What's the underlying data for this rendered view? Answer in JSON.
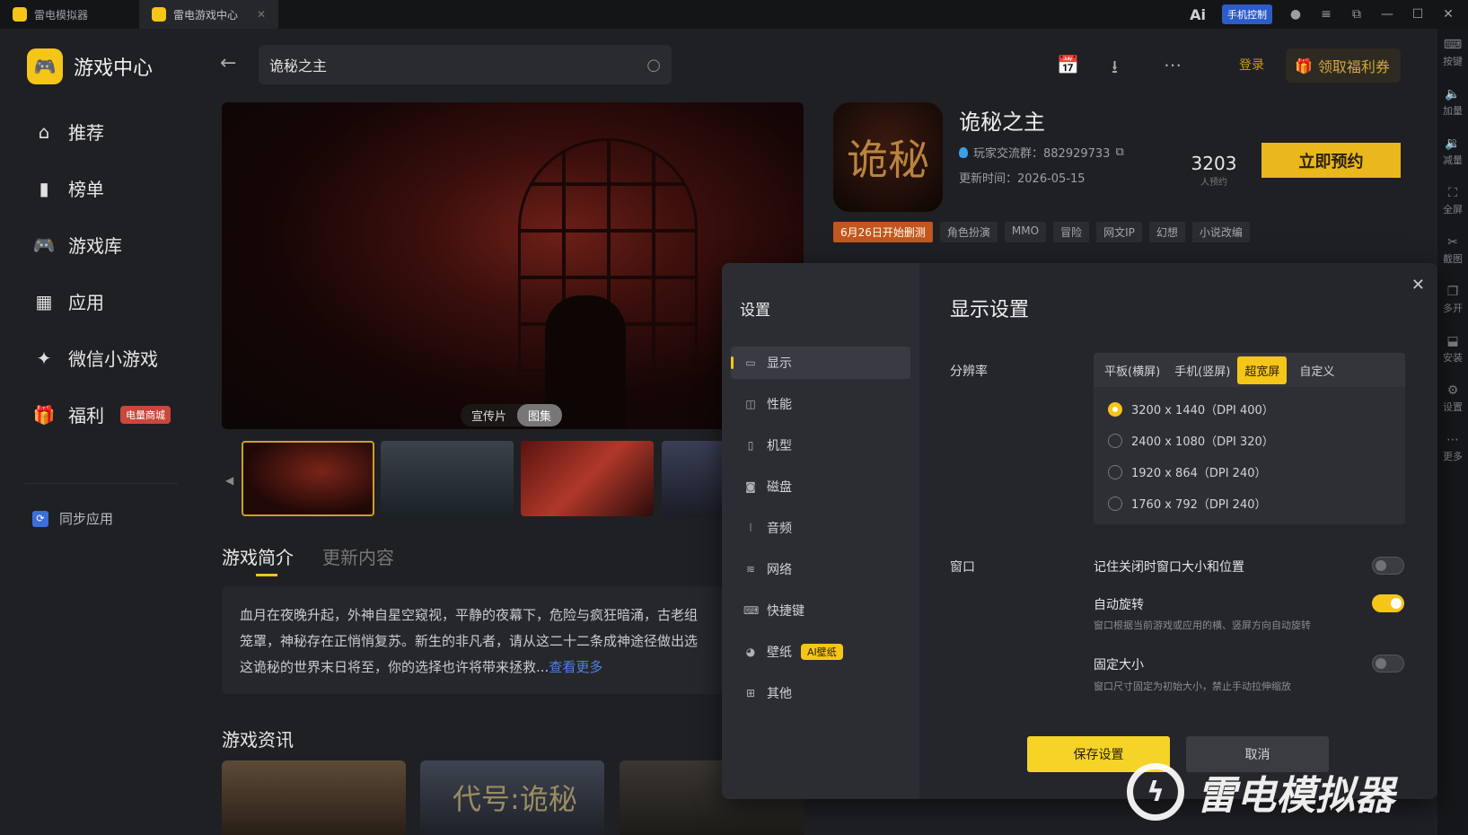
{
  "titlebar": {
    "tabs": [
      {
        "label": "雷电模拟器"
      },
      {
        "label": "雷电游戏中心"
      }
    ],
    "ai_label": "Ai",
    "phone_control": "手机控制"
  },
  "dock": {
    "items": [
      {
        "label": "按键",
        "icon": "keyboard-icon"
      },
      {
        "label": "加量",
        "icon": "volume-up-icon"
      },
      {
        "label": "减量",
        "icon": "volume-down-icon"
      },
      {
        "label": "全屏",
        "icon": "fullscreen-icon"
      },
      {
        "label": "截图",
        "icon": "scissors-icon"
      },
      {
        "label": "多开",
        "icon": "multi-instance-icon"
      },
      {
        "label": "安装",
        "icon": "install-icon"
      },
      {
        "label": "设置",
        "icon": "gear-icon"
      },
      {
        "label": "更多",
        "icon": "more-icon"
      }
    ]
  },
  "sidebar": {
    "brand": "游戏中心",
    "items": [
      {
        "label": "推荐",
        "icon": "home-icon"
      },
      {
        "label": "榜单",
        "icon": "chart-icon"
      },
      {
        "label": "游戏库",
        "icon": "gamepad-icon"
      },
      {
        "label": "应用",
        "icon": "apps-icon"
      },
      {
        "label": "微信小游戏",
        "icon": "mini-game-icon"
      },
      {
        "label": "福利",
        "icon": "gift-icon",
        "badge": "电量商城"
      }
    ],
    "sync": "同步应用"
  },
  "header": {
    "search_value": "诡秘之主",
    "login": "登录",
    "coupon": "领取福利券"
  },
  "media": {
    "tabs": [
      "宣传片",
      "图集"
    ],
    "active_tab": "图集"
  },
  "game": {
    "title": "诡秘之主",
    "icon_text": "诡秘",
    "group": "玩家交流群：882929733",
    "update": "更新时间：2026-05-15",
    "count": "3203",
    "count_label": "人预约",
    "reserve": "立即预约",
    "date_tag": "6月26日开始删测",
    "tags": [
      "角色扮演",
      "MMO",
      "冒险",
      "网文IP",
      "幻想",
      "小说改编"
    ]
  },
  "intro": {
    "tab_active": "游戏简介",
    "tab_other": "更新内容",
    "text": "血月在夜晚升起，外神自星空窥视，平静的夜幕下，危险与疯狂暗涌，古老组笼罩，神秘存在正悄悄复苏。新生的非凡者，请从这二十二条成神途径做出选这诡秘的世界末日将至，你的选择也许将带来拯救...",
    "more": "查看更多"
  },
  "news": {
    "title": "游戏资讯",
    "card2_text": "代号:诡秘"
  },
  "dialog": {
    "title": "设置",
    "menu": [
      {
        "label": "显示",
        "icon": "monitor-icon"
      },
      {
        "label": "性能",
        "icon": "performance-icon"
      },
      {
        "label": "机型",
        "icon": "phone-icon"
      },
      {
        "label": "磁盘",
        "icon": "disk-icon"
      },
      {
        "label": "音频",
        "icon": "audio-icon"
      },
      {
        "label": "网络",
        "icon": "wifi-icon"
      },
      {
        "label": "快捷键",
        "icon": "keyboard-icon"
      },
      {
        "label": "壁纸",
        "icon": "palette-icon",
        "badge": "AI壁纸"
      },
      {
        "label": "其他",
        "icon": "grid-icon"
      }
    ],
    "heading": "显示设置",
    "resolution_label": "分辨率",
    "segments": [
      "平板(横屏)",
      "手机(竖屏)",
      "超宽屏",
      "自定义"
    ],
    "active_segment": "超宽屏",
    "resolutions": [
      {
        "label": "3200 x 1440（DPI 400）",
        "selected": true
      },
      {
        "label": "2400 x 1080（DPI 320）",
        "selected": false
      },
      {
        "label": "1920 x 864（DPI 240）",
        "selected": false
      },
      {
        "label": "1760 x 792（DPI 240）",
        "selected": false
      }
    ],
    "window_label": "窗口",
    "options": [
      {
        "title": "记住关闭时窗口大小和位置",
        "sub": "",
        "on": false
      },
      {
        "title": "自动旋转",
        "sub": "窗口根据当前游戏或应用的横、竖屏方向自动旋转",
        "on": true
      },
      {
        "title": "固定大小",
        "sub": "窗口尺寸固定为初始大小，禁止手动拉伸缩放",
        "on": false
      }
    ],
    "save": "保存设置",
    "cancel": "取消"
  },
  "watermark": "雷电模拟器",
  "colors": {
    "accent": "#f5c518",
    "background": "#1f2024",
    "dialog": "#25262b",
    "link": "#4a82e6"
  }
}
